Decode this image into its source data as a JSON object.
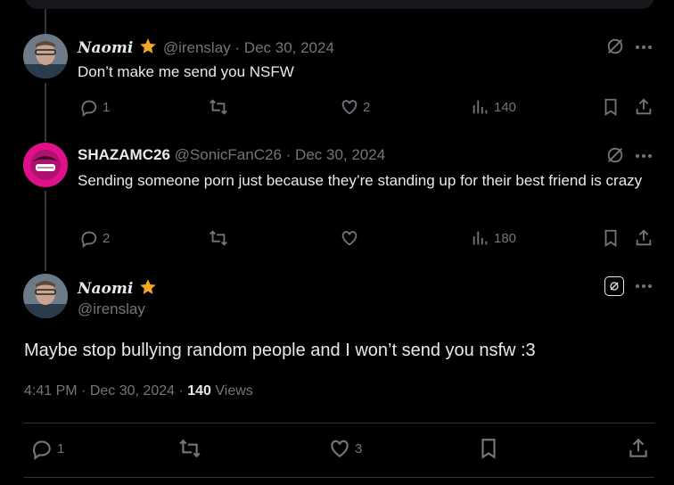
{
  "replies": [
    {
      "display_name": "Naomi",
      "handle": "@irenslay",
      "date": "Dec 30, 2024",
      "text": "Don’t make me send you NSFW",
      "reply_count": "1",
      "like_count": "2",
      "view_count": "140"
    },
    {
      "display_name": "SHAZAMC26",
      "handle": "@SonicFanC26",
      "date": "Dec 30, 2024",
      "text": "Sending someone porn just because they’re standing up for their best friend is crazy",
      "reply_count": "2",
      "like_count": "",
      "view_count": "180"
    }
  ],
  "main_post": {
    "display_name": "Naomi",
    "handle": "@irenslay",
    "text": "Maybe stop bullying random people and I won’t send you nsfw :3",
    "time": "4:41 PM",
    "date": "Dec 30, 2024",
    "views_count": "140",
    "views_label": "Views",
    "reply_count": "1",
    "like_count": "3"
  },
  "separator": "·",
  "colors": {
    "background": "#000000",
    "text": "#e7e9ea",
    "muted": "#71767b",
    "verified_star": "#f5a623"
  },
  "icons": [
    "star-badge",
    "grok",
    "more",
    "reply",
    "retweet",
    "like",
    "views",
    "bookmark",
    "share"
  ]
}
